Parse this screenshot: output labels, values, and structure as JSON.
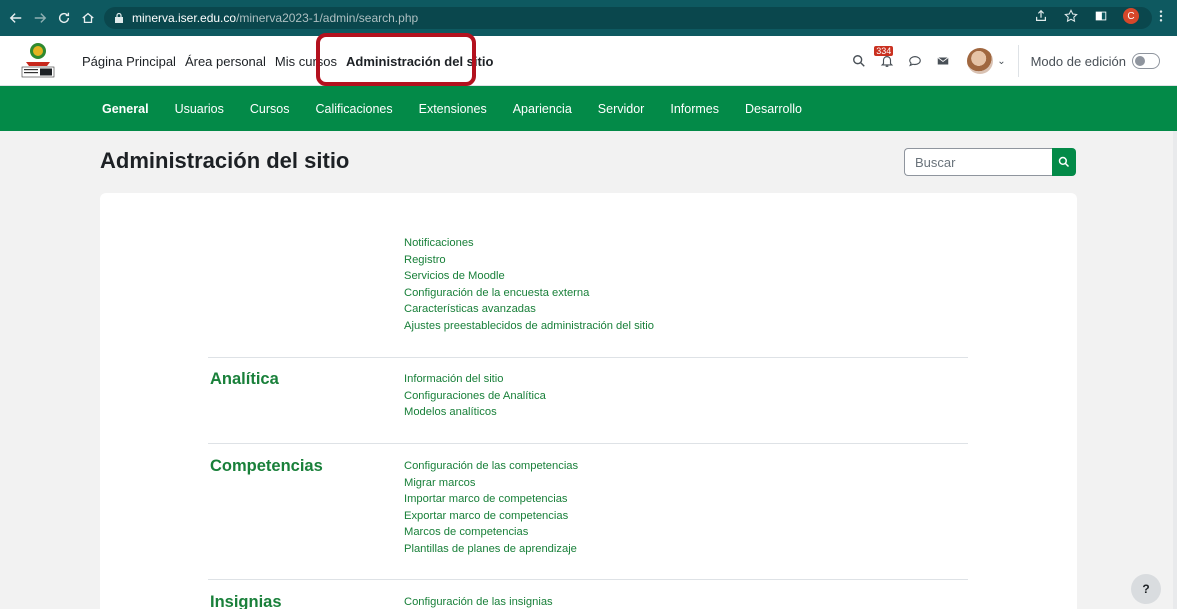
{
  "browser": {
    "url_domain": "minerva.iser.edu.co",
    "url_path": "/minerva2023-1/admin/search.php",
    "profile_initial": "C"
  },
  "header": {
    "nav": [
      "Página Principal",
      "Área personal",
      "Mis cursos",
      "Administración del sitio"
    ],
    "notification_count": "334",
    "edit_mode_label": "Modo de edición"
  },
  "secondary_nav": [
    "General",
    "Usuarios",
    "Cursos",
    "Calificaciones",
    "Extensiones",
    "Apariencia",
    "Servidor",
    "Informes",
    "Desarrollo"
  ],
  "page": {
    "title": "Administración del sitio",
    "search_placeholder": "Buscar"
  },
  "sections": [
    {
      "title": "",
      "links": [
        "Notificaciones",
        "Registro",
        "Servicios de Moodle",
        "Configuración de la encuesta externa",
        "Características avanzadas",
        "Ajustes preestablecidos de administración del sitio"
      ]
    },
    {
      "title": "Analítica",
      "links": [
        "Información del sitio",
        "Configuraciones de Analítica",
        "Modelos analíticos"
      ]
    },
    {
      "title": "Competencias",
      "links": [
        "Configuración de las competencias",
        "Migrar marcos",
        "Importar marco de competencias",
        "Exportar marco de competencias",
        "Marcos de competencias",
        "Plantillas de planes de aprendizaje"
      ]
    },
    {
      "title": "Insignias",
      "links": [
        "Configuración de las insignias"
      ]
    }
  ],
  "help_label": "?"
}
